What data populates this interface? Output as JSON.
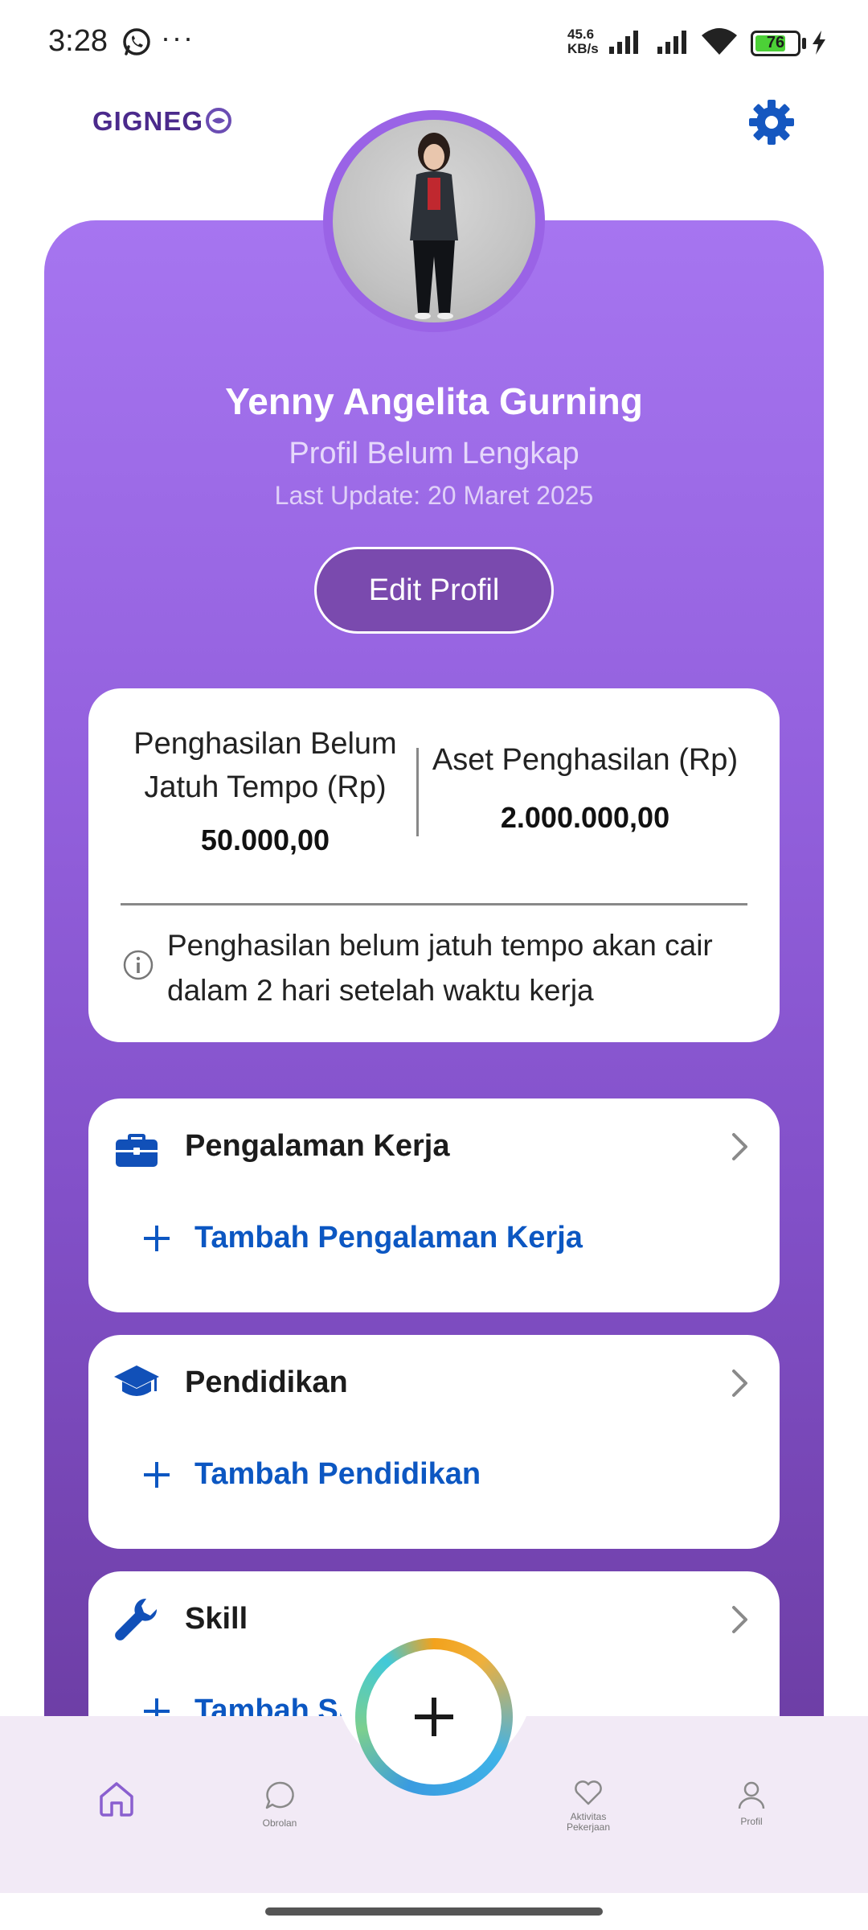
{
  "status_bar": {
    "time": "3:28",
    "more": "···",
    "speed_top": "45.6",
    "speed_unit": "KB/s",
    "battery": "76",
    "battery_level_percent": 76,
    "icons": [
      "whatsapp-icon",
      "signal-icon",
      "signal-icon",
      "wifi-icon",
      "battery-icon",
      "charging-icon"
    ]
  },
  "header": {
    "logo_text": "GIGNEG",
    "settings_icon": "gear-icon"
  },
  "colors": {
    "accent_purple": "#9461de",
    "link_blue": "#0c57c2",
    "icon_blue": "#1150b8"
  },
  "profile": {
    "name": "Yenny Angelita Gurning",
    "status": "Profil Belum Lengkap",
    "last_update": "Last Update: 20 Maret 2025",
    "edit_label": "Edit Profil"
  },
  "earnings": {
    "pending_label": "Penghasilan Belum Jatuh Tempo (Rp)",
    "pending_value": "50.000,00",
    "assets_label": "Aset Penghasilan (Rp)",
    "assets_value": "2.000.000,00",
    "note": "Penghasilan belum jatuh tempo akan cair dalam 2 hari setelah waktu kerja"
  },
  "sections": [
    {
      "title": "Pengalaman Kerja",
      "add_label": "Tambah Pengalaman Kerja",
      "icon": "briefcase-icon"
    },
    {
      "title": "Pendidikan",
      "add_label": "Tambah Pendidikan",
      "icon": "graduation-cap-icon"
    },
    {
      "title": "Skill",
      "add_label": "Tambah Skill",
      "icon": "wrench-icon"
    }
  ],
  "bottom_nav": {
    "fab_icon": "plus-icon",
    "items": [
      {
        "label": "",
        "icon": "home-icon"
      },
      {
        "label": "Obrolan",
        "icon": "chat-icon"
      },
      {
        "label": "Aktivitas Pekerjaan",
        "icon": "heart-icon"
      },
      {
        "label": "Profil",
        "icon": "person-icon"
      }
    ]
  }
}
